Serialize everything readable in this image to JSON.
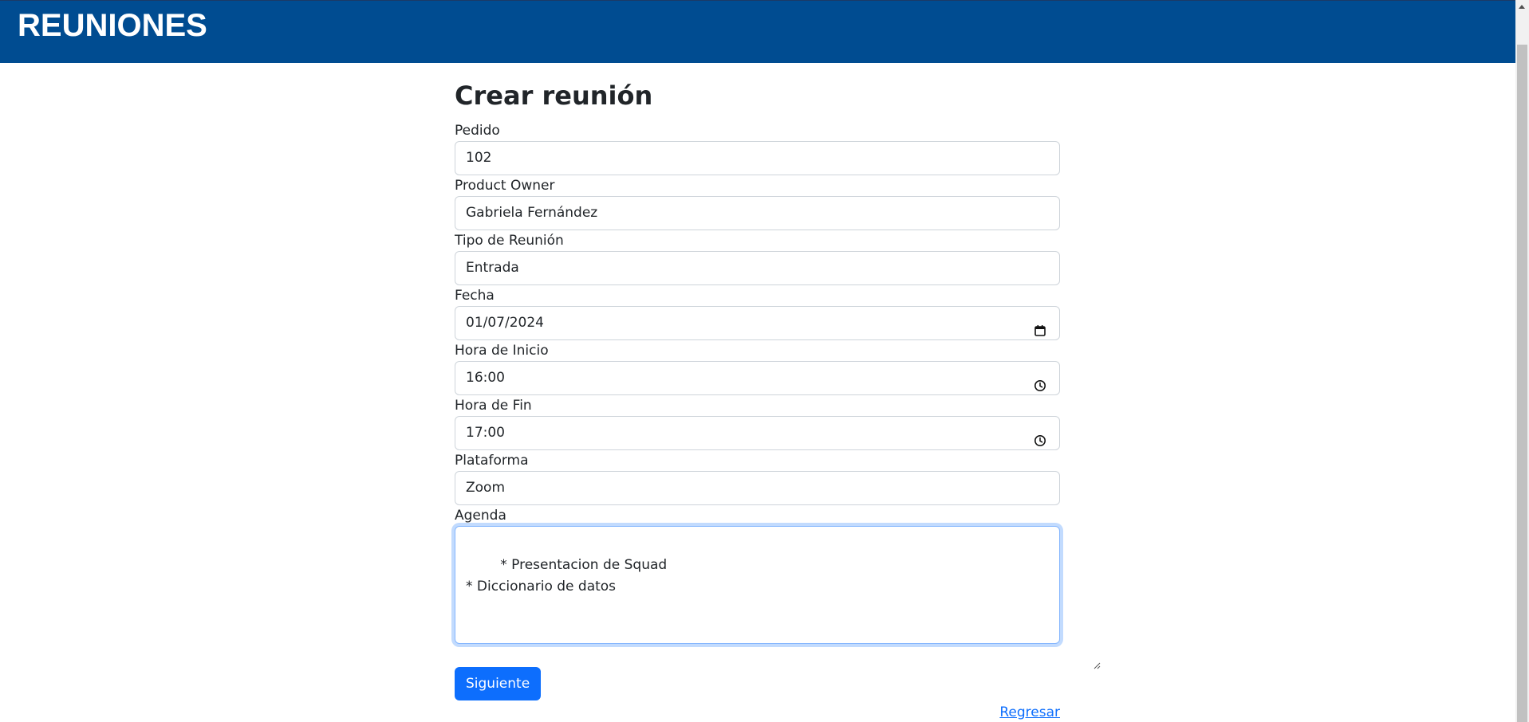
{
  "header": {
    "title": "REUNIONES"
  },
  "form": {
    "title": "Crear reunión",
    "fields": [
      {
        "label": "Pedido",
        "value": "102"
      },
      {
        "label": "Product Owner",
        "value": "Gabriela Fernández"
      },
      {
        "label": "Tipo de Reunión",
        "value": "Entrada"
      },
      {
        "label": "Fecha",
        "value": "01/07/2024",
        "icon": "calendar-icon"
      },
      {
        "label": "Hora de Inicio",
        "value": "16:00",
        "icon": "clock-icon"
      },
      {
        "label": "Hora de Fin",
        "value": "17:00",
        "icon": "clock-icon"
      },
      {
        "label": "Plataforma",
        "value": "Zoom"
      }
    ],
    "agenda": {
      "label": "Agenda",
      "value": "* Presentacion de Squad\n* Diccionario de datos"
    },
    "submit_label": "Siguiente",
    "back_label": "Regresar"
  },
  "colors": {
    "header_bg": "#004c91",
    "primary": "#0d6efd"
  }
}
